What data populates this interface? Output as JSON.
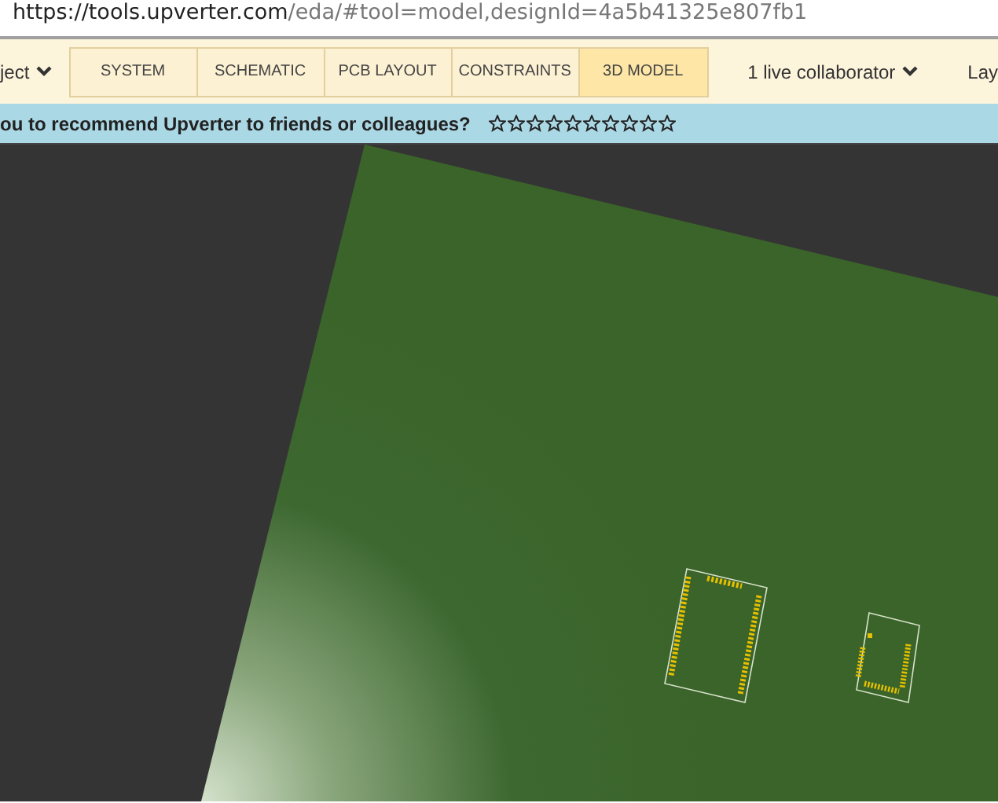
{
  "address_bar": {
    "url_host": "https://tools.upverter.com",
    "url_path": "/eda/#tool=model,designId=4a5b41325e807fb1"
  },
  "toolbar": {
    "project_menu": "ject",
    "tabs": [
      {
        "label": "SYSTEM",
        "selected": false
      },
      {
        "label": "SCHEMATIC",
        "selected": false
      },
      {
        "label": "PCB LAYOUT",
        "selected": false
      },
      {
        "label": "CONSTRAINTS",
        "selected": false
      },
      {
        "label": "3D MODEL",
        "selected": true
      }
    ],
    "collaborators": "1 live collaborator",
    "layout_menu": "Lay"
  },
  "survey": {
    "question": "ou to recommend Upverter to friends or colleagues?",
    "stars": 0
  }
}
